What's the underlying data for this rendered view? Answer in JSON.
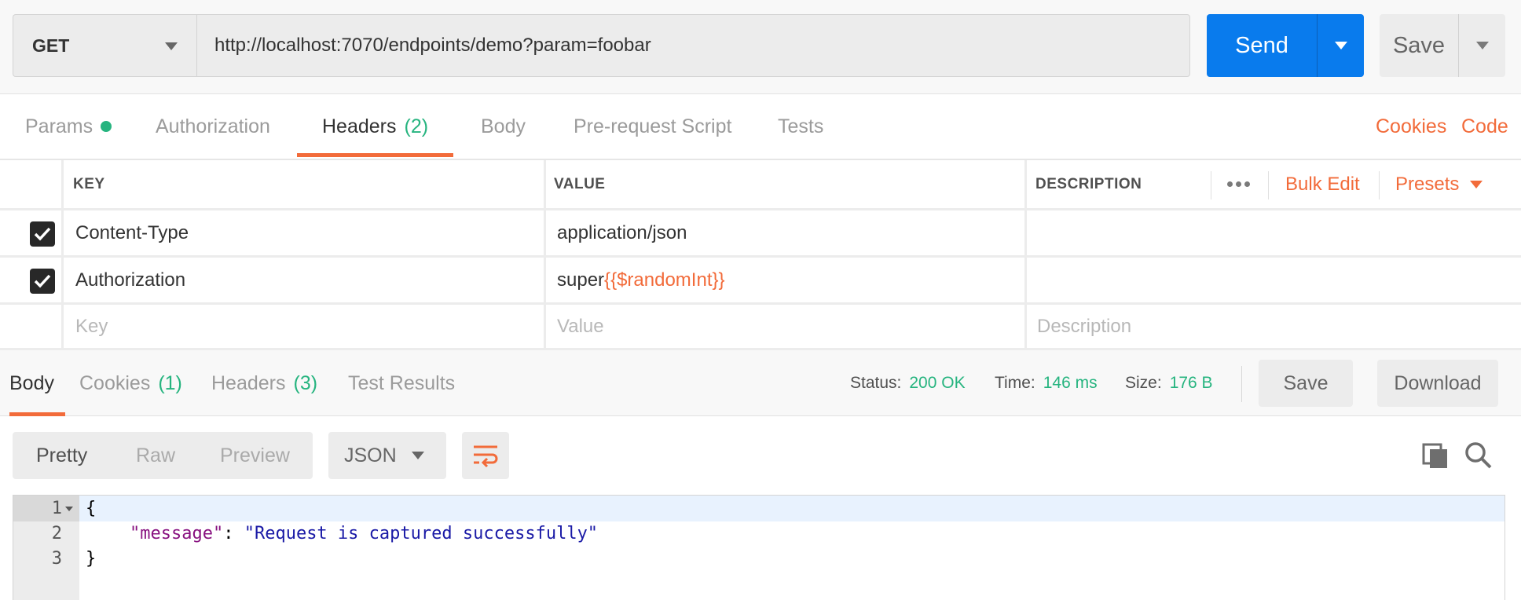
{
  "request": {
    "method": "GET",
    "url": "http://localhost:7070/endpoints/demo?param=foobar",
    "send_label": "Send",
    "save_label": "Save"
  },
  "request_tabs": {
    "params": "Params",
    "authorization": "Authorization",
    "headers": "Headers",
    "headers_count": "(2)",
    "body": "Body",
    "prerequest": "Pre-request Script",
    "tests": "Tests",
    "cookies_link": "Cookies",
    "code_link": "Code"
  },
  "headers_table": {
    "col_key": "KEY",
    "col_value": "VALUE",
    "col_description": "DESCRIPTION",
    "bulk_edit": "Bulk Edit",
    "presets": "Presets",
    "rows": [
      {
        "key": "Content-Type",
        "value_plain": "application/json",
        "value_var": "",
        "checked": true
      },
      {
        "key": "Authorization",
        "value_plain": "super",
        "value_var": "{{$randomInt}}",
        "checked": true
      }
    ],
    "placeholder_key": "Key",
    "placeholder_value": "Value",
    "placeholder_description": "Description"
  },
  "response": {
    "tabs": {
      "body": "Body",
      "cookies": "Cookies",
      "cookies_count": "(1)",
      "headers": "Headers",
      "headers_count": "(3)",
      "test_results": "Test Results"
    },
    "status_label": "Status:",
    "status_value": "200 OK",
    "time_label": "Time:",
    "time_value": "146 ms",
    "size_label": "Size:",
    "size_value": "176 B",
    "save_label": "Save",
    "download_label": "Download"
  },
  "body_view": {
    "modes": [
      "Pretty",
      "Raw",
      "Preview"
    ],
    "active_mode": "Pretty",
    "format": "JSON"
  },
  "editor": {
    "lines": [
      {
        "no": "1",
        "text": "{"
      },
      {
        "no": "2",
        "key": "\"message\"",
        "sep": ": ",
        "str": "\"Request is captured successfully\""
      },
      {
        "no": "3",
        "text": "}"
      }
    ]
  },
  "colors": {
    "accent": "#f26b3a",
    "send": "#097bed",
    "ok_green": "#26b47f"
  }
}
